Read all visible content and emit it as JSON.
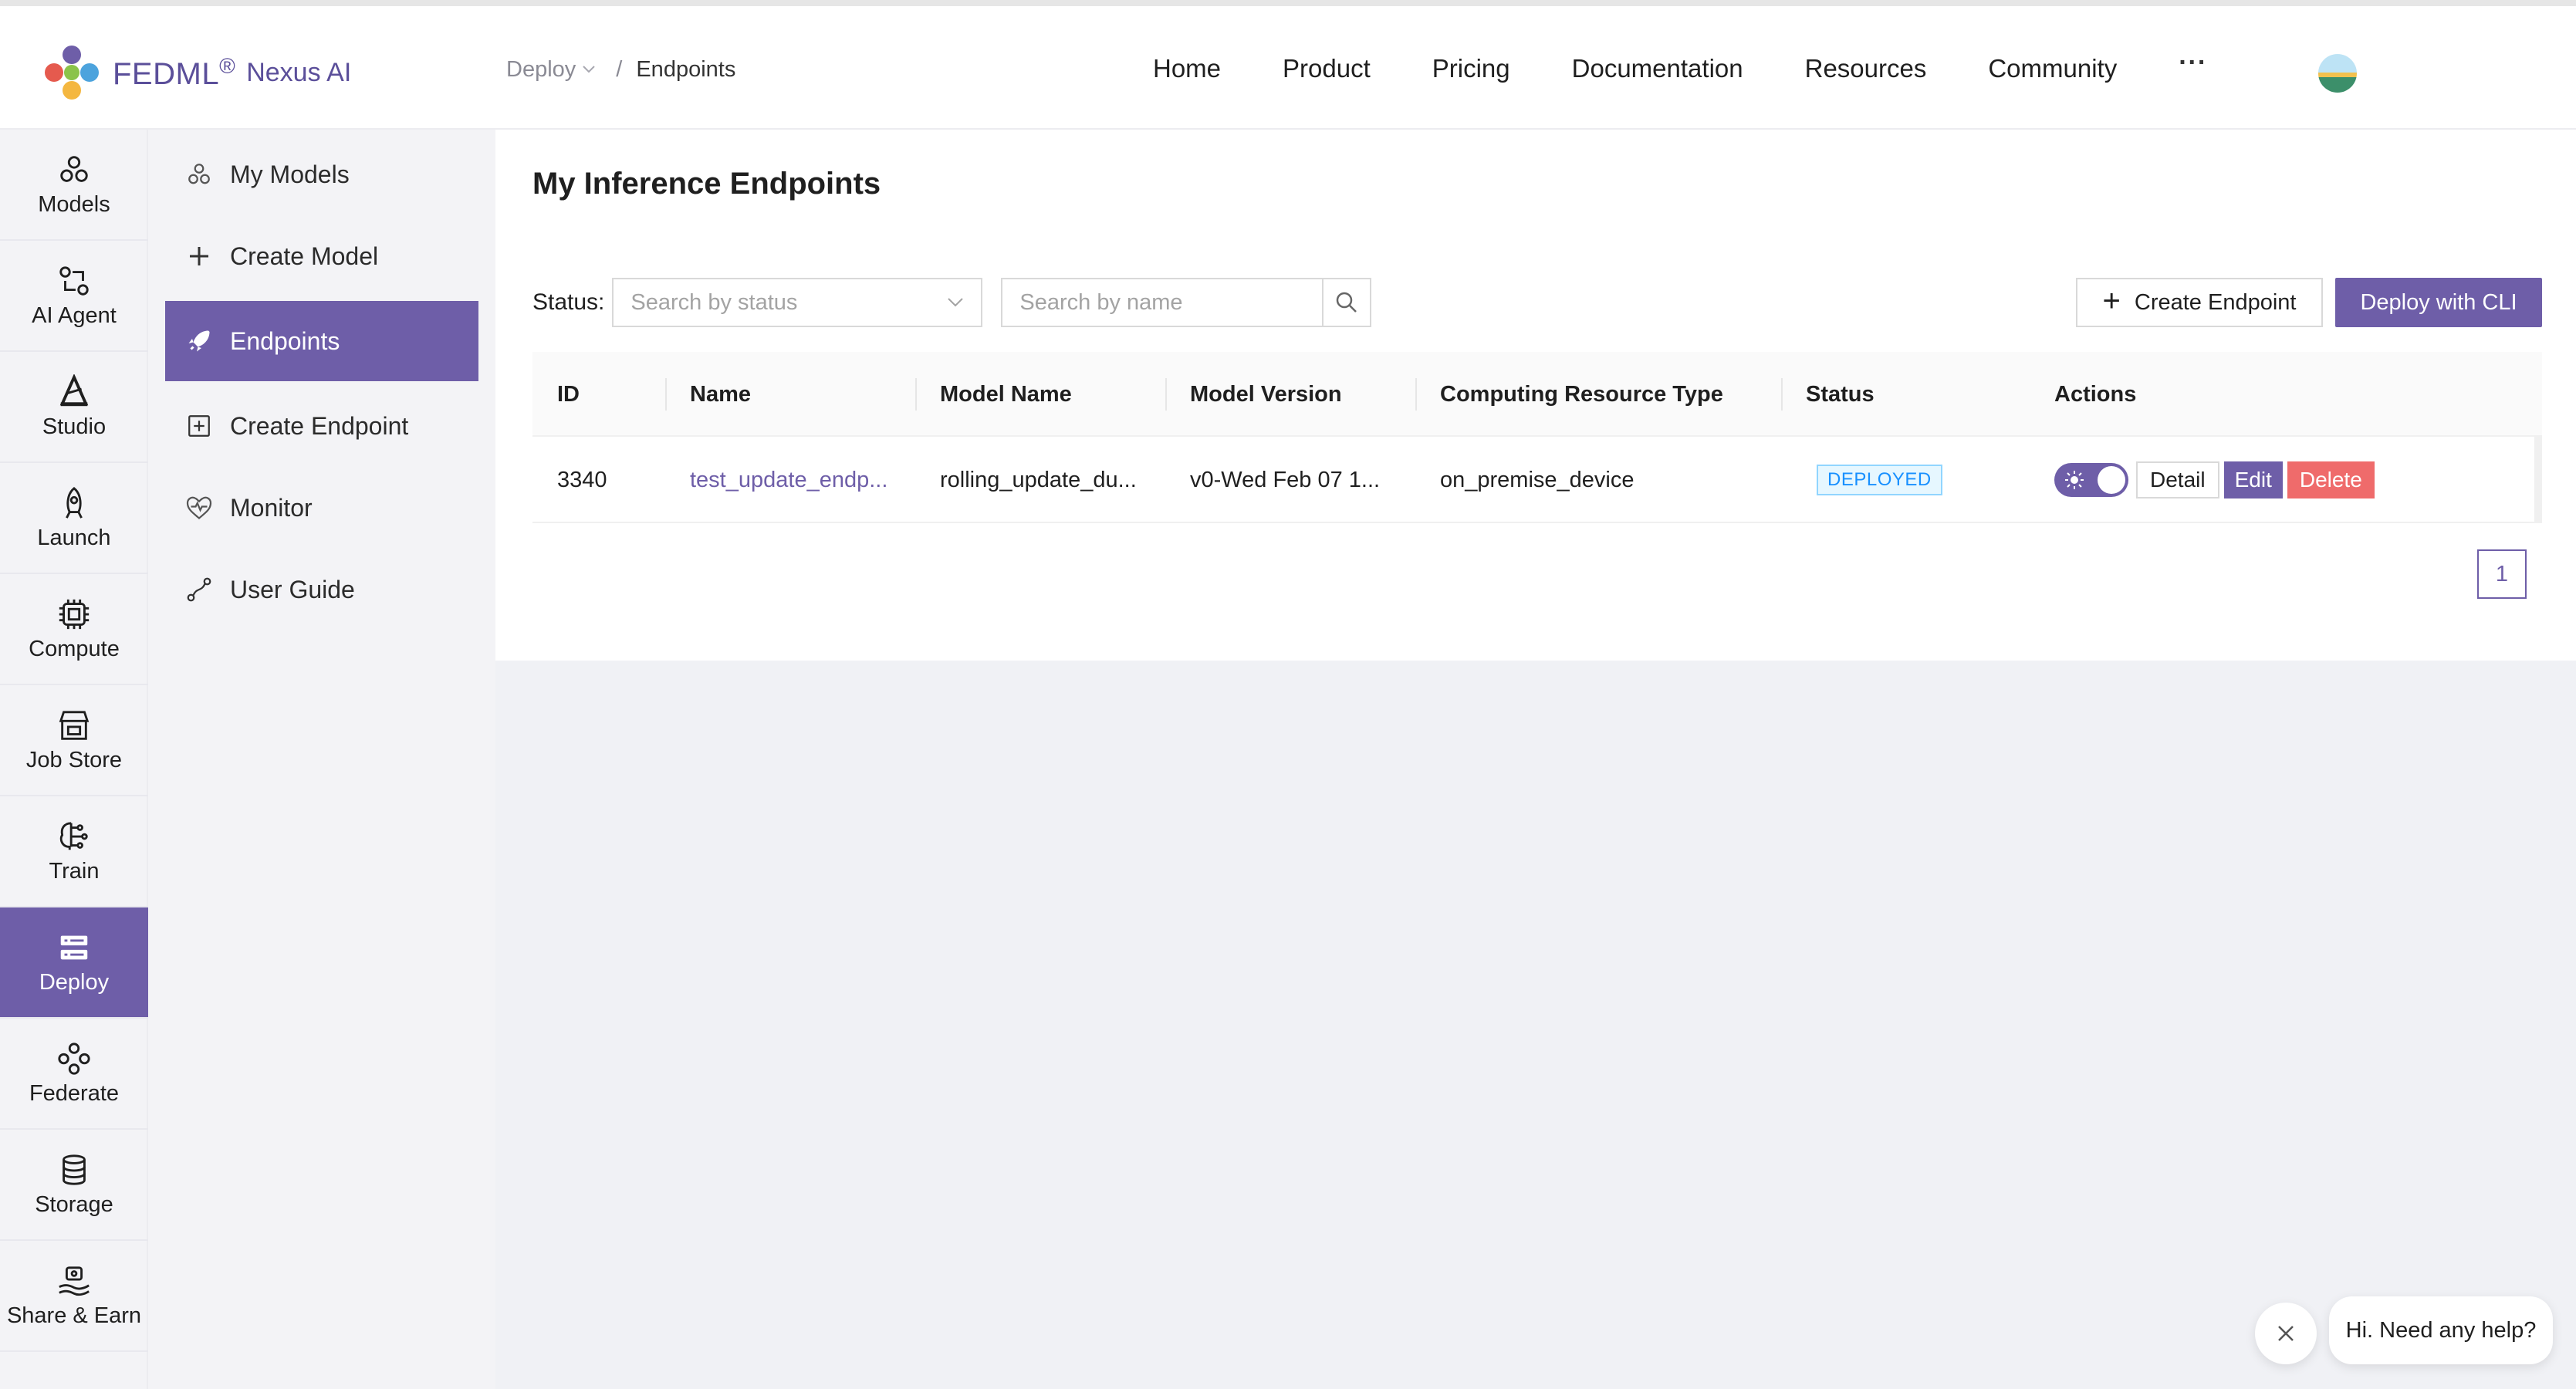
{
  "header": {
    "logo_name": "FEDML",
    "logo_reg": "®",
    "logo_sub": "Nexus AI",
    "breadcrumb": {
      "first": "Deploy",
      "separator": "/",
      "last": "Endpoints"
    },
    "nav": [
      {
        "label": "Home"
      },
      {
        "label": "Product"
      },
      {
        "label": "Pricing"
      },
      {
        "label": "Documentation"
      },
      {
        "label": "Resources"
      },
      {
        "label": "Community"
      }
    ],
    "more": "···"
  },
  "rail": {
    "items": [
      {
        "label": "Models",
        "icon": "models-icon"
      },
      {
        "label": "AI Agent",
        "icon": "ai-agent-icon"
      },
      {
        "label": "Studio",
        "icon": "studio-icon"
      },
      {
        "label": "Launch",
        "icon": "launch-icon"
      },
      {
        "label": "Compute",
        "icon": "compute-icon"
      },
      {
        "label": "Job Store",
        "icon": "job-store-icon"
      },
      {
        "label": "Train",
        "icon": "train-icon"
      },
      {
        "label": "Deploy",
        "icon": "deploy-icon",
        "active": true
      },
      {
        "label": "Federate",
        "icon": "federate-icon"
      },
      {
        "label": "Storage",
        "icon": "storage-icon"
      },
      {
        "label": "Share & Earn",
        "icon": "share-earn-icon"
      }
    ]
  },
  "subnav": {
    "items": [
      {
        "label": "My Models",
        "icon": "models-icon"
      },
      {
        "label": "Create Model",
        "icon": "plus-icon"
      },
      {
        "label": "Endpoints",
        "icon": "rocket-icon",
        "active": true
      },
      {
        "label": "Create Endpoint",
        "icon": "plus-square-icon"
      },
      {
        "label": "Monitor",
        "icon": "monitor-icon"
      },
      {
        "label": "User Guide",
        "icon": "guide-icon"
      }
    ]
  },
  "main": {
    "title": "My Inference Endpoints",
    "filters": {
      "status_label": "Status:",
      "status_placeholder": "Search by status",
      "name_placeholder": "Search by name"
    },
    "buttons": {
      "create_endpoint": "Create Endpoint",
      "deploy_cli": "Deploy with CLI"
    },
    "table": {
      "columns": [
        "ID",
        "Name",
        "Model Name",
        "Model Version",
        "Computing Resource Type",
        "Status",
        "Actions"
      ],
      "rows": [
        {
          "id": "3340",
          "name": "test_update_endp...",
          "model_name": "rolling_update_du...",
          "model_version": "v0-Wed Feb 07 1...",
          "resource_type": "on_premise_device",
          "status": "DEPLOYED",
          "actions": {
            "toggle_on": true,
            "detail": "Detail",
            "edit": "Edit",
            "delete": "Delete"
          }
        }
      ]
    },
    "pagination": {
      "current": "1"
    }
  },
  "help": {
    "text": "Hi. Need any help?"
  },
  "colors": {
    "accent": "#6e5ea8",
    "danger": "#ef6b6b",
    "badge_blue": "#1890ff"
  }
}
